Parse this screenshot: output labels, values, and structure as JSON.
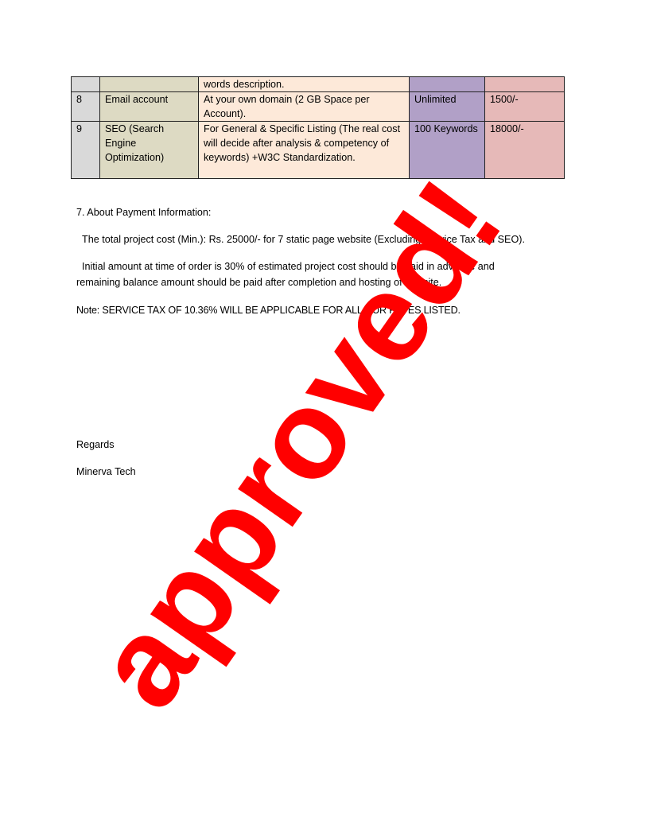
{
  "table": {
    "rows": [
      {
        "num": "",
        "service": "",
        "description": "words description.",
        "qty": "",
        "price": ""
      },
      {
        "num": "8",
        "service": "Email account",
        "description": "At your own domain (2 GB Space per Account).",
        "qty": "Unlimited",
        "price": "1500/-"
      },
      {
        "num": "9",
        "service": "SEO (Search Engine Optimization)",
        "description": "For General & Specific Listing (The real cost will decide after analysis & competency of keywords) +W3C Standardization.",
        "qty": "100 Keywords",
        "price": "18000/-"
      }
    ]
  },
  "payment": {
    "heading": "7. About Payment Information:",
    "total_cost": "The total project cost (Min.): Rs. 25000/-  for 7 static page website   (Excluding Service Tax and SEO).",
    "initial_line1": "Initial amount at time of order is 30% of estimated project cost should be paid in advance and",
    "initial_line2": "remaining balance amount should be paid after completion and hosting of website.",
    "note": "Note: SERVICE TAX OF 10.36% WILL BE APPLICABLE FOR ALL OUR RATES LISTED."
  },
  "closing": {
    "regards": "Regards",
    "company": "Minerva Tech"
  },
  "stamp": {
    "text": "approved!",
    "color": "#ff0000"
  }
}
